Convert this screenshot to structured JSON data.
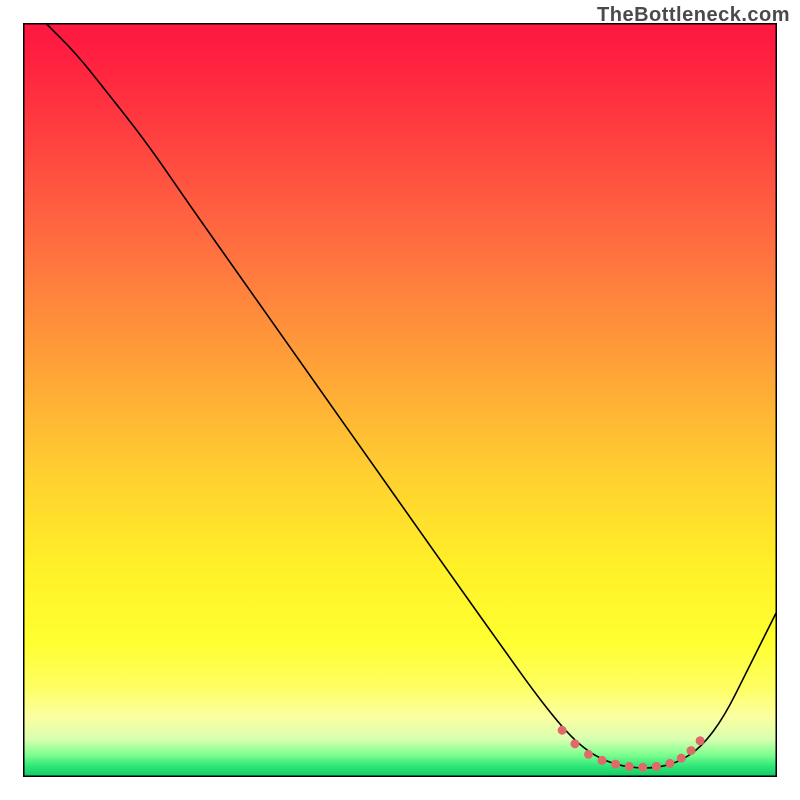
{
  "watermark": "TheBottleneck.com",
  "chart_data": {
    "type": "line",
    "title": "",
    "xlabel": "",
    "ylabel": "",
    "xlim": [
      0,
      100
    ],
    "ylim": [
      0,
      100
    ],
    "gradient": {
      "stops": [
        {
          "offset": 0.0,
          "color": "#ff1740"
        },
        {
          "offset": 0.05,
          "color": "#ff2140"
        },
        {
          "offset": 0.15,
          "color": "#ff4040"
        },
        {
          "offset": 0.3,
          "color": "#ff7040"
        },
        {
          "offset": 0.45,
          "color": "#ffa038"
        },
        {
          "offset": 0.6,
          "color": "#ffd030"
        },
        {
          "offset": 0.72,
          "color": "#fff028"
        },
        {
          "offset": 0.82,
          "color": "#ffff30"
        },
        {
          "offset": 0.88,
          "color": "#feff60"
        },
        {
          "offset": 0.92,
          "color": "#fcffa0"
        },
        {
          "offset": 0.95,
          "color": "#d8ffb0"
        },
        {
          "offset": 0.97,
          "color": "#80ff90"
        },
        {
          "offset": 0.985,
          "color": "#30e878"
        },
        {
          "offset": 1.0,
          "color": "#10c860"
        }
      ]
    },
    "black_curve": {
      "comment": "main bottleneck curve stroke=black width~1.5; points are (x,y) with y=0 bottom, y=100 top",
      "points": [
        [
          3,
          100
        ],
        [
          7,
          96
        ],
        [
          11,
          91
        ],
        [
          16.5,
          84
        ],
        [
          22,
          76
        ],
        [
          28,
          67.5
        ],
        [
          34,
          59
        ],
        [
          40,
          50.5
        ],
        [
          46,
          42
        ],
        [
          52,
          33.5
        ],
        [
          58,
          25
        ],
        [
          63,
          18
        ],
        [
          68,
          11
        ],
        [
          72,
          6
        ],
        [
          75,
          3.3
        ],
        [
          78,
          1.8
        ],
        [
          81,
          1.2
        ],
        [
          84,
          1.2
        ],
        [
          87,
          2.0
        ],
        [
          90,
          4.0
        ],
        [
          93,
          8
        ],
        [
          96,
          14
        ],
        [
          100,
          22
        ]
      ]
    },
    "pink_dots": {
      "comment": "highlighted optimal range markers near valley floor",
      "color": "#e06a6a",
      "radius": 4.5,
      "points": [
        [
          71.5,
          6.2
        ],
        [
          73.2,
          4.4
        ],
        [
          75.0,
          3.0
        ],
        [
          76.8,
          2.2
        ],
        [
          78.6,
          1.7
        ],
        [
          80.4,
          1.4
        ],
        [
          82.2,
          1.3
        ],
        [
          84.0,
          1.4
        ],
        [
          85.8,
          1.8
        ],
        [
          87.3,
          2.5
        ],
        [
          88.6,
          3.5
        ],
        [
          89.8,
          4.8
        ]
      ]
    }
  }
}
